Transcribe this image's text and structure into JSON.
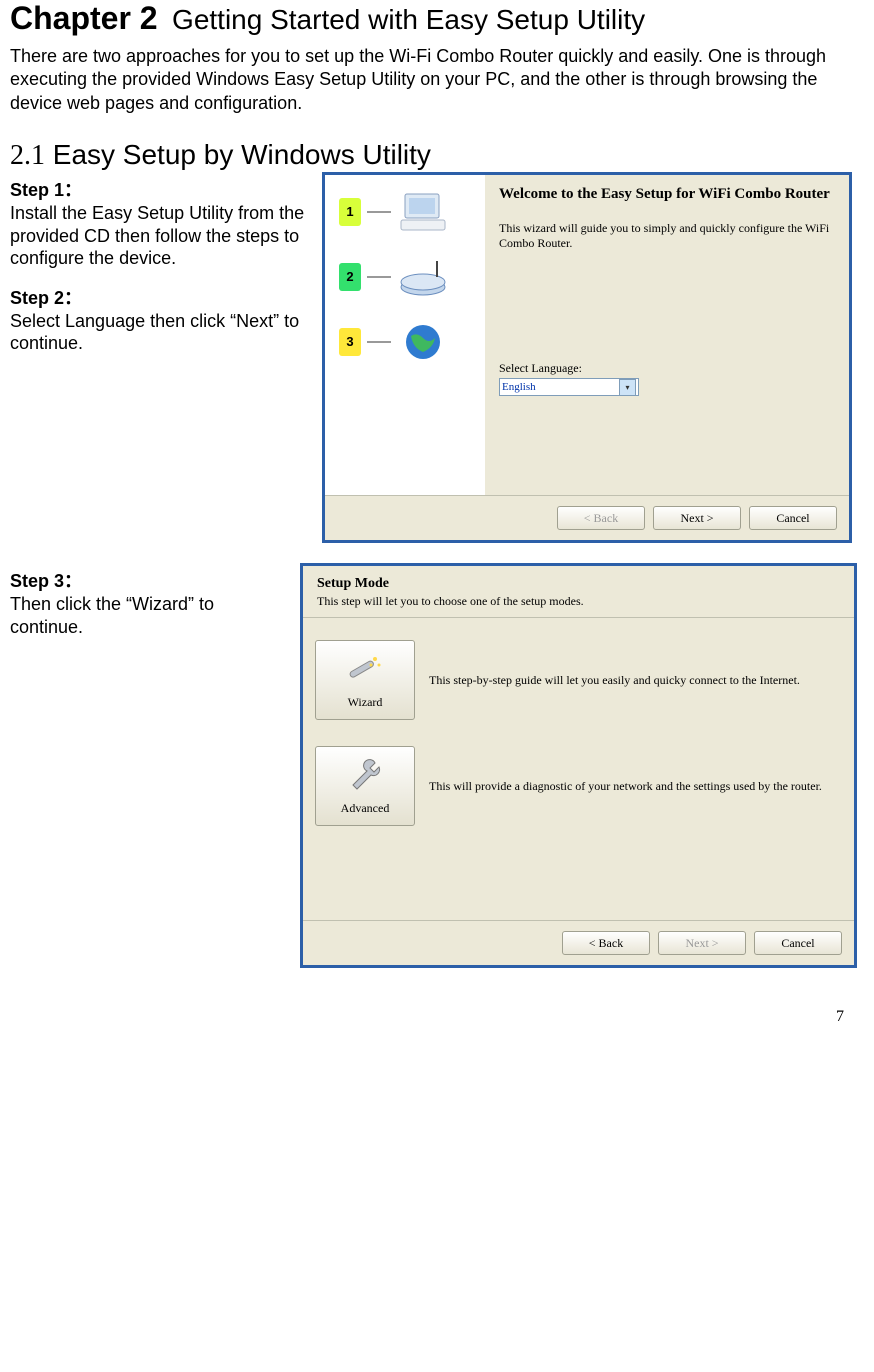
{
  "chapter": {
    "number": "Chapter 2",
    "title": "Getting Started with Easy Setup Utility"
  },
  "intro": "There are two approaches for you to set up the Wi-Fi Combo Router quickly and easily. One is through executing the provided Windows Easy Setup Utility on your PC, and the other is through browsing the device web pages and configuration.",
  "section": {
    "num": "2.1",
    "title": "Easy Setup by Windows Utility"
  },
  "steps": {
    "s1": {
      "label": "Step 1：",
      "text": "Install the Easy Setup Utility from the provided CD then follow the steps to configure the device."
    },
    "s2": {
      "label": "Step 2：",
      "text": "Select Language then click “Next” to continue."
    },
    "s3": {
      "label": "Step 3：",
      "text": "Then click the “Wizard” to continue."
    }
  },
  "dialog1": {
    "badges": {
      "b1": "1",
      "b2": "2",
      "b3": "3"
    },
    "welcome_title": "Welcome to the Easy Setup for WiFi Combo Router",
    "welcome_desc": "This wizard will guide you to simply and quickly configure the WiFi Combo Router.",
    "lang_label": "Select Language:",
    "lang_value": "English",
    "btn_back": "< Back",
    "btn_next": "Next >",
    "btn_cancel": "Cancel"
  },
  "dialog2": {
    "title": "Setup Mode",
    "subtitle": "This step will let you to choose one of the setup modes.",
    "wizard_label": "Wizard",
    "wizard_desc": "This step-by-step guide will let you easily and quicky connect to the Internet.",
    "advanced_label": "Advanced",
    "advanced_desc": "This will provide a diagnostic of your network and the settings used by the router.",
    "btn_back": "< Back",
    "btn_next": "Next >",
    "btn_cancel": "Cancel"
  },
  "page_number": "7"
}
